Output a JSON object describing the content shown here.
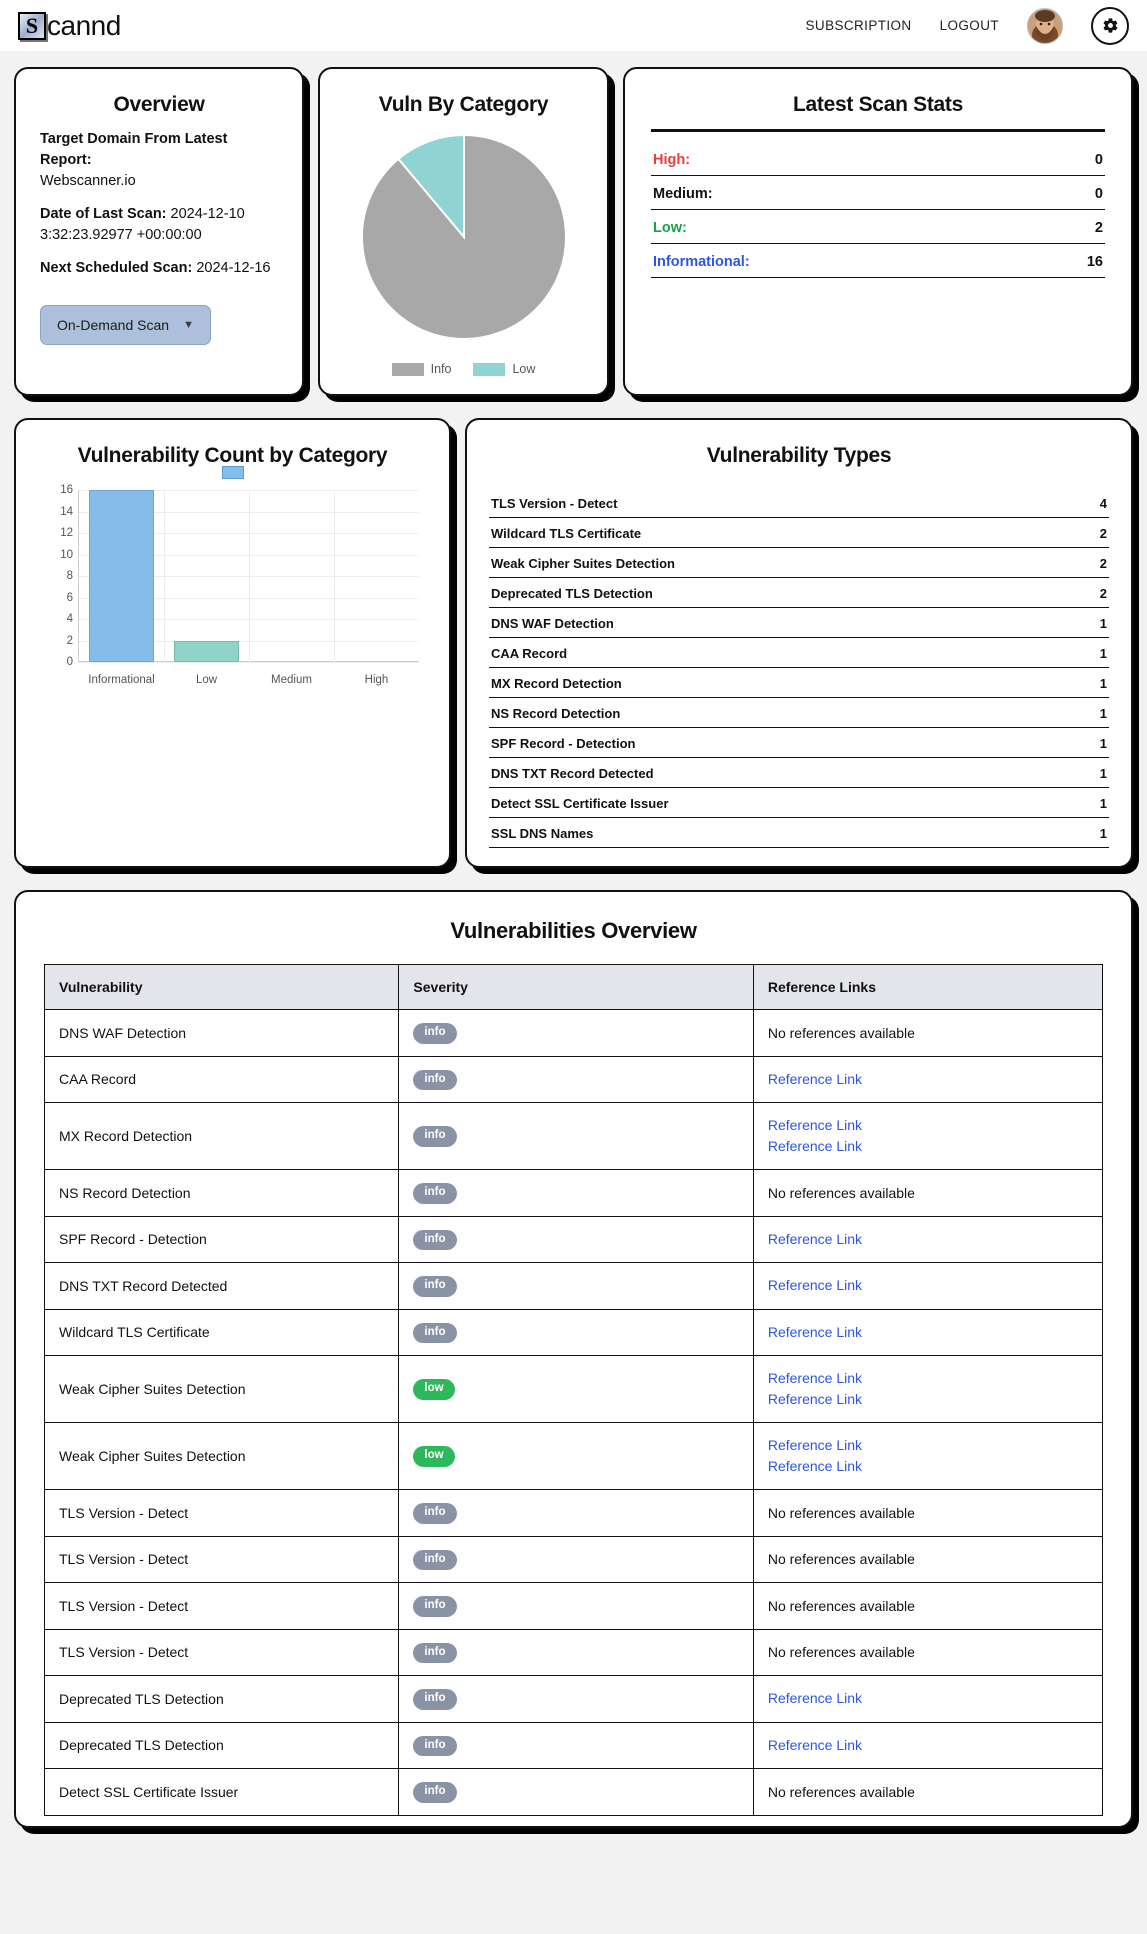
{
  "header": {
    "logo_badge": "S",
    "logo_text": "cannd",
    "nav": [
      {
        "label": "SUBSCRIPTION",
        "name": "subscription"
      },
      {
        "label": "LOGOUT",
        "name": "logout"
      }
    ],
    "avatar_icon": "user-avatar",
    "settings_icon": "gear-icon"
  },
  "overview": {
    "title": "Overview",
    "target_domain_label": "Target Domain From Latest Report:",
    "target_domain_value": "Webscanner.io",
    "last_scan_label": "Date of Last Scan:",
    "last_scan_value": "2024-12-10",
    "last_scan_time": "3:32:23.92977 +00:00:00",
    "next_scan_label": "Next Scheduled Scan:",
    "next_scan_value": "2024-12-16",
    "scan_button": "On-Demand Scan",
    "scan_button_chevron": "chevron-down-icon"
  },
  "pie_card": {
    "title": "Vuln By Category"
  },
  "stats": {
    "title": "Latest Scan Stats",
    "rows": [
      {
        "label": "High:",
        "value": "0",
        "color": "#ef3b3b"
      },
      {
        "label": "Medium:",
        "value": "0",
        "color": "#111111"
      },
      {
        "label": "Low:",
        "value": "2",
        "color": "#16a34a"
      },
      {
        "label": "Informational:",
        "value": "16",
        "color": "#2b55e6"
      }
    ]
  },
  "bar_card": {
    "title": "Vulnerability Count by Category"
  },
  "vuln_types": {
    "title": "Vulnerability Types",
    "rows": [
      {
        "label": "TLS Version - Detect",
        "count": "4"
      },
      {
        "label": "Wildcard TLS Certificate",
        "count": "2"
      },
      {
        "label": "Weak Cipher Suites Detection",
        "count": "2"
      },
      {
        "label": "Deprecated TLS Detection",
        "count": "2"
      },
      {
        "label": "DNS WAF Detection",
        "count": "1"
      },
      {
        "label": "CAA Record",
        "count": "1"
      },
      {
        "label": "MX Record Detection",
        "count": "1"
      },
      {
        "label": "NS Record Detection",
        "count": "1"
      },
      {
        "label": "SPF Record - Detection",
        "count": "1"
      },
      {
        "label": "DNS TXT Record Detected",
        "count": "1"
      },
      {
        "label": "Detect SSL Certificate Issuer",
        "count": "1"
      },
      {
        "label": "SSL DNS Names",
        "count": "1"
      }
    ]
  },
  "vulns_table": {
    "title": "Vulnerabilities Overview",
    "columns": [
      "Vulnerability",
      "Severity",
      "Reference Links"
    ],
    "no_refs_text": "No references available",
    "link_text": "Reference Link",
    "rows": [
      {
        "vulnerability": "DNS WAF Detection",
        "severity": "info",
        "links": 0
      },
      {
        "vulnerability": "CAA Record",
        "severity": "info",
        "links": 1
      },
      {
        "vulnerability": "MX Record Detection",
        "severity": "info",
        "links": 2
      },
      {
        "vulnerability": "NS Record Detection",
        "severity": "info",
        "links": 0
      },
      {
        "vulnerability": "SPF Record - Detection",
        "severity": "info",
        "links": 1
      },
      {
        "vulnerability": "DNS TXT Record Detected",
        "severity": "info",
        "links": 1
      },
      {
        "vulnerability": "Wildcard TLS Certificate",
        "severity": "info",
        "links": 1
      },
      {
        "vulnerability": "Weak Cipher Suites Detection",
        "severity": "low",
        "links": 2
      },
      {
        "vulnerability": "Weak Cipher Suites Detection",
        "severity": "low",
        "links": 2
      },
      {
        "vulnerability": "TLS Version - Detect",
        "severity": "info",
        "links": 0
      },
      {
        "vulnerability": "TLS Version - Detect",
        "severity": "info",
        "links": 0
      },
      {
        "vulnerability": "TLS Version - Detect",
        "severity": "info",
        "links": 0
      },
      {
        "vulnerability": "TLS Version - Detect",
        "severity": "info",
        "links": 0
      },
      {
        "vulnerability": "Deprecated TLS Detection",
        "severity": "info",
        "links": 1
      },
      {
        "vulnerability": "Deprecated TLS Detection",
        "severity": "info",
        "links": 1
      },
      {
        "vulnerability": "Detect SSL Certificate Issuer",
        "severity": "info",
        "links": 0
      }
    ]
  },
  "chart_data": [
    {
      "type": "pie",
      "title": "Vuln By Category",
      "labels": [
        "Info",
        "Low"
      ],
      "values": [
        16,
        2
      ],
      "colors": [
        "#a8a8a8",
        "#8fd3d3"
      ],
      "legend": "bottom",
      "start_angle_deg": 0,
      "direction": "counterclockwise"
    },
    {
      "type": "bar",
      "title": "Vulnerability Count by Category",
      "categories": [
        "Informational",
        "Low",
        "Medium",
        "High"
      ],
      "values": [
        16,
        2,
        0,
        0
      ],
      "colors": [
        "#85bdea",
        "#8fd3c8",
        "#85bdea",
        "#85bdea"
      ],
      "xlabel": "",
      "ylabel": "",
      "ylim": [
        0,
        16
      ],
      "yticks": [
        0,
        2,
        4,
        6,
        8,
        10,
        12,
        14,
        16
      ],
      "grid": true,
      "legend": "top"
    }
  ]
}
